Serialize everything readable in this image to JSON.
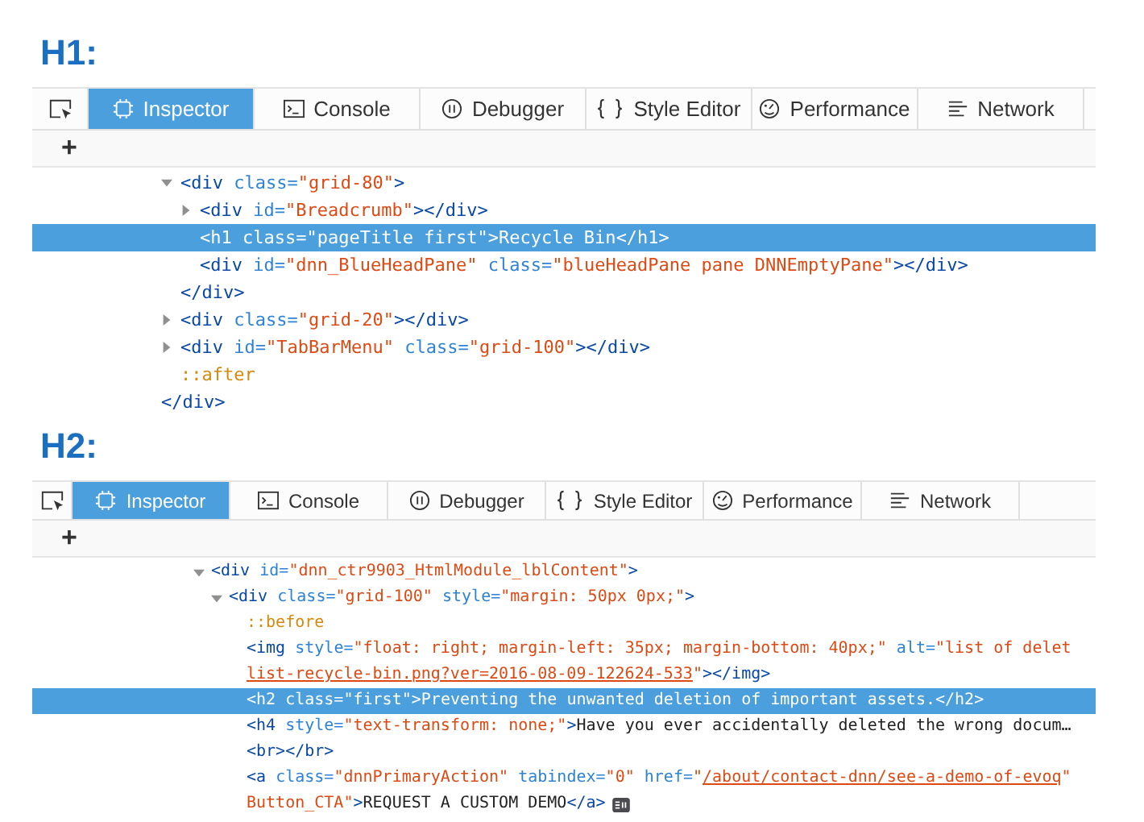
{
  "sections": [
    {
      "heading": "H1:",
      "toolbar": {
        "tabs": [
          {
            "kind": "inspector",
            "label": "Inspector",
            "selected": true
          },
          {
            "kind": "console",
            "label": "Console",
            "selected": false
          },
          {
            "kind": "debugger",
            "label": "Debugger",
            "selected": false
          },
          {
            "kind": "style-editor",
            "label": "Style Editor",
            "selected": false
          },
          {
            "kind": "performance",
            "label": "Performance",
            "selected": false
          },
          {
            "kind": "network",
            "label": "Network",
            "selected": false
          }
        ],
        "add_button": "+"
      },
      "tree": [
        {
          "children": [
            {
              "expanded": true,
              "selected": false,
              "lines": [
                [
                  {
                    "kind": "tag",
                    "text": "<div"
                  },
                  {
                    "kind": "attr",
                    "text": " class="
                  },
                  {
                    "kind": "value",
                    "text": "\"grid-80\""
                  },
                  {
                    "kind": "tag",
                    "text": ">"
                  }
                ]
              ],
              "children": [
                {
                  "expanded": false,
                  "selected": false,
                  "lines": [
                    [
                      {
                        "kind": "tag",
                        "text": "<div"
                      },
                      {
                        "kind": "attr",
                        "text": " id="
                      },
                      {
                        "kind": "value",
                        "text": "\"Breadcrumb\""
                      },
                      {
                        "kind": "tag",
                        "text": "></div>"
                      }
                    ]
                  ]
                },
                {
                  "selected": true,
                  "lines": [
                    [
                      {
                        "kind": "tag",
                        "text": "<h1"
                      },
                      {
                        "kind": "attr",
                        "text": " class="
                      },
                      {
                        "kind": "value",
                        "text": "\"pageTitle first\""
                      },
                      {
                        "kind": "tag",
                        "text": ">"
                      },
                      {
                        "kind": "text",
                        "text": "Recycle Bin"
                      },
                      {
                        "kind": "tag",
                        "text": "</h1>"
                      }
                    ]
                  ]
                },
                {
                  "selected": false,
                  "lines": [
                    [
                      {
                        "kind": "tag",
                        "text": "<div"
                      },
                      {
                        "kind": "attr",
                        "text": " id="
                      },
                      {
                        "kind": "value",
                        "text": "\"dnn_BlueHeadPane\""
                      },
                      {
                        "kind": "attr",
                        "text": " class="
                      },
                      {
                        "kind": "value",
                        "text": "\"blueHeadPane pane DNNEmptyPane\""
                      },
                      {
                        "kind": "tag",
                        "text": "></div>"
                      }
                    ]
                  ]
                }
              ],
              "close": [
                {
                  "kind": "tag",
                  "text": "</div>"
                }
              ]
            },
            {
              "expanded": false,
              "selected": false,
              "lines": [
                [
                  {
                    "kind": "tag",
                    "text": "<div"
                  },
                  {
                    "kind": "attr",
                    "text": " class="
                  },
                  {
                    "kind": "value",
                    "text": "\"grid-20\""
                  },
                  {
                    "kind": "tag",
                    "text": "></div>"
                  }
                ]
              ]
            },
            {
              "expanded": false,
              "selected": false,
              "lines": [
                [
                  {
                    "kind": "tag",
                    "text": "<div"
                  },
                  {
                    "kind": "attr",
                    "text": " id="
                  },
                  {
                    "kind": "value",
                    "text": "\"TabBarMenu\""
                  },
                  {
                    "kind": "attr",
                    "text": " class="
                  },
                  {
                    "kind": "value",
                    "text": "\"grid-100\""
                  },
                  {
                    "kind": "tag",
                    "text": "></div>"
                  }
                ]
              ]
            },
            {
              "selected": false,
              "lines": [
                [
                  {
                    "kind": "pseudo",
                    "text": "::after"
                  }
                ]
              ]
            }
          ],
          "close": [
            {
              "kind": "tag",
              "text": "</div>"
            }
          ]
        }
      ]
    },
    {
      "heading": "H2:",
      "toolbar": {
        "tabs": [
          {
            "kind": "inspector",
            "label": "Inspector",
            "selected": true
          },
          {
            "kind": "console",
            "label": "Console",
            "selected": false
          },
          {
            "kind": "debugger",
            "label": "Debugger",
            "selected": false
          },
          {
            "kind": "style-editor",
            "label": "Style Editor",
            "selected": false
          },
          {
            "kind": "performance",
            "label": "Performance",
            "selected": false
          },
          {
            "kind": "network",
            "label": "Network",
            "selected": false
          }
        ],
        "add_button": "+"
      },
      "tree": [
        {
          "expanded": true,
          "selected": false,
          "lines": [
            [
              {
                "kind": "tag",
                "text": "<div"
              },
              {
                "kind": "attr",
                "text": " id="
              },
              {
                "kind": "value",
                "text": "\"dnn_ctr9903_HtmlModule_lblContent\""
              },
              {
                "kind": "tag",
                "text": ">"
              }
            ]
          ],
          "children": [
            {
              "expanded": true,
              "selected": false,
              "lines": [
                [
                  {
                    "kind": "tag",
                    "text": "<div"
                  },
                  {
                    "kind": "attr",
                    "text": " class="
                  },
                  {
                    "kind": "value",
                    "text": "\"grid-100\""
                  },
                  {
                    "kind": "attr",
                    "text": " style="
                  },
                  {
                    "kind": "value",
                    "text": "\"margin: 50px 0px;\""
                  },
                  {
                    "kind": "tag",
                    "text": ">"
                  }
                ]
              ],
              "children": [
                {
                  "selected": false,
                  "lines": [
                    [
                      {
                        "kind": "pseudo",
                        "text": "::before"
                      }
                    ]
                  ]
                },
                {
                  "selected": false,
                  "lines": [
                    [
                      {
                        "kind": "tag",
                        "text": "<img"
                      },
                      {
                        "kind": "attr",
                        "text": " style="
                      },
                      {
                        "kind": "value",
                        "text": "\"float: right; margin-left: 35px; margin-bottom: 40px;\""
                      },
                      {
                        "kind": "attr",
                        "text": " alt="
                      },
                      {
                        "kind": "value",
                        "text": "\"list of delet"
                      }
                    ],
                    [
                      {
                        "kind": "link",
                        "text": "list-recycle-bin.png?ver=2016-08-09-122624-533"
                      },
                      {
                        "kind": "value",
                        "text": "\""
                      },
                      {
                        "kind": "tag",
                        "text": "></img>"
                      }
                    ]
                  ]
                },
                {
                  "selected": true,
                  "lines": [
                    [
                      {
                        "kind": "tag",
                        "text": "<h2"
                      },
                      {
                        "kind": "attr",
                        "text": " class="
                      },
                      {
                        "kind": "value",
                        "text": "\"first\""
                      },
                      {
                        "kind": "tag",
                        "text": ">"
                      },
                      {
                        "kind": "text",
                        "text": "Preventing the unwanted deletion of important assets."
                      },
                      {
                        "kind": "tag",
                        "text": "</h2>"
                      }
                    ]
                  ]
                },
                {
                  "selected": false,
                  "lines": [
                    [
                      {
                        "kind": "tag",
                        "text": "<h4"
                      },
                      {
                        "kind": "attr",
                        "text": " style="
                      },
                      {
                        "kind": "value",
                        "text": "\"text-transform: none;\""
                      },
                      {
                        "kind": "tag",
                        "text": ">"
                      },
                      {
                        "kind": "text",
                        "text": "Have you ever accidentally deleted the wrong docum…"
                      }
                    ]
                  ]
                },
                {
                  "selected": false,
                  "lines": [
                    [
                      {
                        "kind": "tag",
                        "text": "<br></br>"
                      }
                    ]
                  ]
                },
                {
                  "selected": false,
                  "event_badge": true,
                  "lines": [
                    [
                      {
                        "kind": "tag",
                        "text": "<a"
                      },
                      {
                        "kind": "attr",
                        "text": " class="
                      },
                      {
                        "kind": "value",
                        "text": "\"dnnPrimaryAction\""
                      },
                      {
                        "kind": "attr",
                        "text": " tabindex="
                      },
                      {
                        "kind": "value",
                        "text": "\"0\""
                      },
                      {
                        "kind": "attr",
                        "text": " href="
                      },
                      {
                        "kind": "value",
                        "text": "\""
                      },
                      {
                        "kind": "link",
                        "text": "/about/contact-dnn/see-a-demo-of-evoq"
                      },
                      {
                        "kind": "value",
                        "text": "\""
                      }
                    ],
                    [
                      {
                        "kind": "value",
                        "text": "Button_CTA\""
                      },
                      {
                        "kind": "tag",
                        "text": ">"
                      },
                      {
                        "kind": "text",
                        "text": "REQUEST A CUSTOM DEMO"
                      },
                      {
                        "kind": "tag",
                        "text": "</a>"
                      }
                    ]
                  ]
                }
              ]
            }
          ]
        }
      ]
    }
  ]
}
